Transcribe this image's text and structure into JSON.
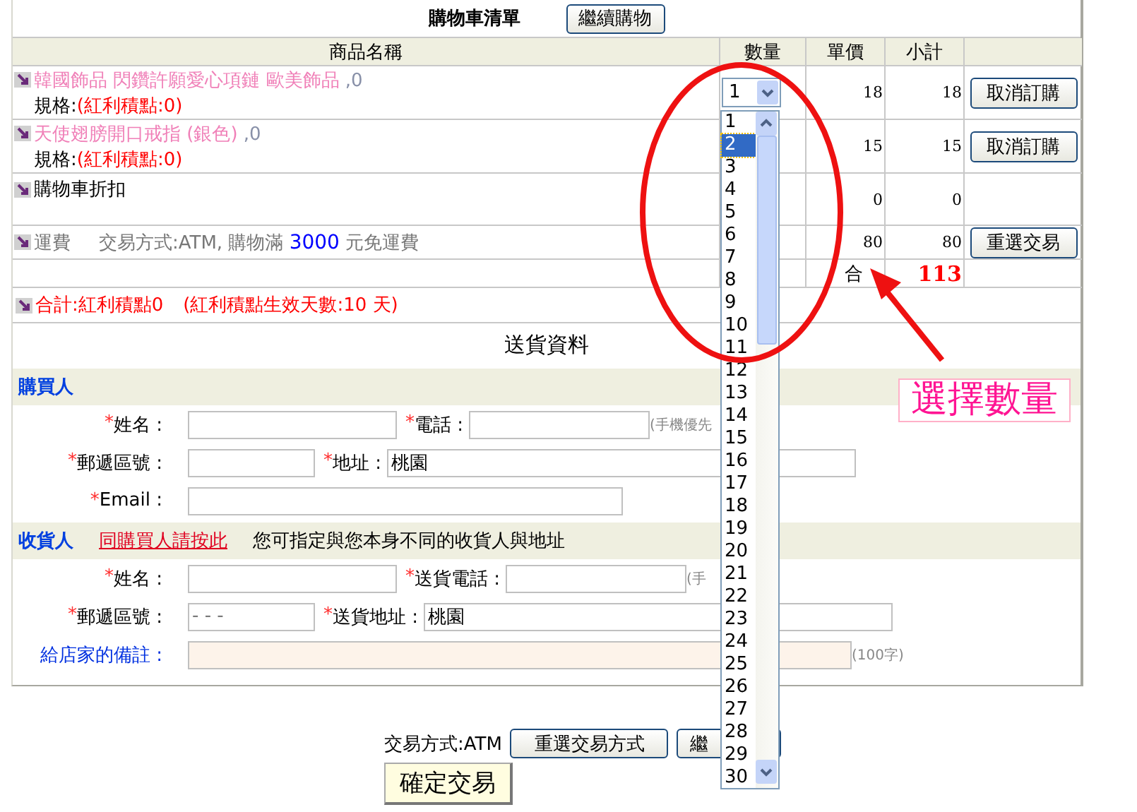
{
  "cart": {
    "title": "購物車清單",
    "continue_button": "繼續購物",
    "columns": [
      "商品名稱",
      "數量",
      "單價",
      "小計"
    ],
    "rows": [
      {
        "kind": "product",
        "name": "韓國飾品 閃鑽許願愛心項鏈 歐美飾品 ",
        "extra": ",0",
        "spec_label": "規格:",
        "bonus": "(紅利積點:0)",
        "quantity": "1",
        "price": "18",
        "subtotal": "18",
        "action": "取消訂購"
      },
      {
        "kind": "product",
        "name": "天使翅膀開口戒指 (銀色) ",
        "extra": ",0",
        "spec_label": "規格:",
        "bonus": "(紅利積點:0)",
        "price": "15",
        "subtotal": "15",
        "action": "取消訂購"
      },
      {
        "kind": "discount",
        "name": "購物車折扣",
        "price": "0",
        "subtotal": "0"
      },
      {
        "kind": "shipping",
        "name": "運費",
        "method": "交易方式:ATM, 購物滿",
        "threshold": "3000",
        "suffix": "元免運費",
        "price": "80",
        "subtotal": "80",
        "action": "重選交易"
      }
    ],
    "total": {
      "label": "合",
      "amount": "113"
    },
    "bonus_summary": {
      "points": "合計:紅利積點0",
      "validity": "(紅利積點生效天數:10 天)"
    }
  },
  "delivery": {
    "title": "送貨資料",
    "buyer": {
      "heading": "購買人",
      "rows": [
        [
          {
            "kind": "text",
            "mark": "*",
            "label": "姓名 :"
          },
          {
            "kind": "text",
            "mark": "*",
            "label": "電話 :",
            "note": "(手機優先"
          }
        ],
        [
          {
            "kind": "text",
            "mark": "*",
            "label": "郵遞區號 :"
          },
          {
            "kind": "text",
            "mark": "*",
            "label": "地址 :",
            "value": "桃園"
          }
        ],
        [
          {
            "kind": "text",
            "mark": "*",
            "label": "Email :"
          }
        ]
      ]
    },
    "receiver": {
      "heading": "收貨人",
      "link": "同購買人請按此",
      "hint": "您可指定與您本身不同的收貨人與地址",
      "rows": [
        [
          {
            "kind": "text",
            "mark": "*",
            "label": "姓名 :"
          },
          {
            "kind": "text",
            "mark": "*",
            "label": "送貨電話 :",
            "note": "(手"
          }
        ],
        [
          {
            "kind": "text",
            "mark": "*",
            "label": "郵遞區號 :",
            "placeholder": "- - -"
          },
          {
            "kind": "text",
            "mark": "*",
            "label": "送貨地址 :",
            "value": "桃園"
          }
        ],
        [
          {
            "kind": "remark",
            "label": "給店家的備註 :",
            "note": "(100字)"
          }
        ]
      ]
    }
  },
  "checkout": {
    "method": "交易方式:ATM",
    "reselect_button": "重選交易方式",
    "continue_button": "繼",
    "confirm_button": "確定交易"
  },
  "quantity_dropdown": {
    "options": [
      {
        "label": "1",
        "selected": false
      },
      {
        "label": "2",
        "selected": true
      },
      {
        "label": "3",
        "selected": false
      },
      {
        "label": "4",
        "selected": false
      },
      {
        "label": "5",
        "selected": false
      },
      {
        "label": "6",
        "selected": false
      },
      {
        "label": "7",
        "selected": false
      },
      {
        "label": "8",
        "selected": false
      },
      {
        "label": "9",
        "selected": false
      },
      {
        "label": "10",
        "selected": false
      },
      {
        "label": "11",
        "selected": false
      },
      {
        "label": "12",
        "selected": false
      },
      {
        "label": "13",
        "selected": false
      },
      {
        "label": "14",
        "selected": false
      },
      {
        "label": "15",
        "selected": false
      },
      {
        "label": "16",
        "selected": false
      },
      {
        "label": "17",
        "selected": false
      },
      {
        "label": "18",
        "selected": false
      },
      {
        "label": "19",
        "selected": false
      },
      {
        "label": "20",
        "selected": false
      },
      {
        "label": "21",
        "selected": false
      },
      {
        "label": "22",
        "selected": false
      },
      {
        "label": "23",
        "selected": false
      },
      {
        "label": "24",
        "selected": false
      },
      {
        "label": "25",
        "selected": false
      },
      {
        "label": "26",
        "selected": false
      },
      {
        "label": "27",
        "selected": false
      },
      {
        "label": "28",
        "selected": false
      },
      {
        "label": "29",
        "selected": false
      },
      {
        "label": "30",
        "selected": false
      }
    ]
  },
  "annotation": {
    "label": "選擇數量"
  }
}
